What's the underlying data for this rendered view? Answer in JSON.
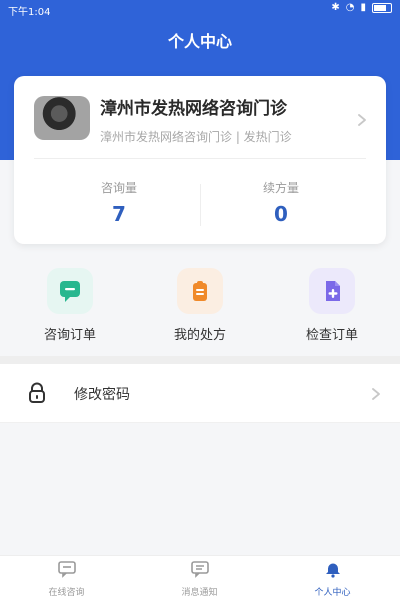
{
  "status_bar": {
    "time": "下午1:04",
    "icons": [
      "bluetooth-icon",
      "wifi-icon",
      "signal-icon",
      "battery-icon"
    ]
  },
  "header": {
    "title": "个人中心",
    "background_color": "#2f63d8"
  },
  "profile": {
    "name": "漳州市发热网络咨询门诊",
    "subtitle": "漳州市发热网络咨询门诊 | 发热门诊",
    "stats": [
      {
        "label": "咨询量",
        "value": "7"
      },
      {
        "label": "续方量",
        "value": "0"
      }
    ]
  },
  "quick_actions": [
    {
      "label": "咨询订单",
      "icon": "chat-icon",
      "color": "#28b78f"
    },
    {
      "label": "我的处方",
      "icon": "clipboard-icon",
      "color": "#f08a2a"
    },
    {
      "label": "检查订单",
      "icon": "document-plus-icon",
      "color": "#7b69e8"
    }
  ],
  "menu": [
    {
      "label": "修改密码",
      "icon": "lock-icon"
    }
  ],
  "tabbar": {
    "items": [
      {
        "label": "在线咨询",
        "icon": "chat-tab-icon",
        "active": false
      },
      {
        "label": "消息通知",
        "icon": "message-tab-icon",
        "active": false
      },
      {
        "label": "个人中心",
        "icon": "bell-tab-icon",
        "active": true
      }
    ],
    "active_color": "#2f5fbe"
  }
}
